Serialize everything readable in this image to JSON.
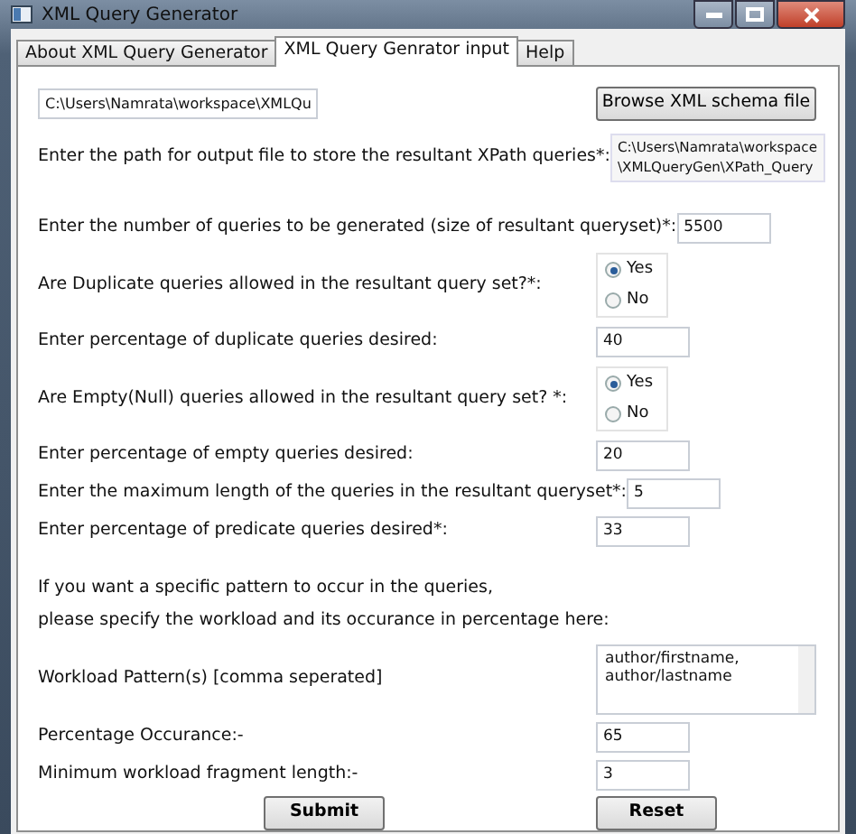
{
  "window": {
    "title": "XML Query Generator"
  },
  "tabs": [
    {
      "label": "About XML Query Generator",
      "selected": false
    },
    {
      "label": "XML Query Genrator input",
      "selected": true
    },
    {
      "label": "Help",
      "selected": false
    }
  ],
  "schema": {
    "value": "C:\\Users\\Namrata\\workspace\\XMLQu",
    "button": "Browse XML schema file"
  },
  "rows": [
    {
      "kind": "path",
      "label": "Enter the path for output file to store the resultant XPath queries*:",
      "lines": [
        "C:\\Users\\Namrata\\workspace",
        "\\XMLQueryGen\\XPath_Query"
      ]
    },
    {
      "kind": "input",
      "label": "Enter the number of queries to be generated (size of resultant queryset)*:",
      "value": "5500"
    },
    {
      "kind": "radio",
      "label": "Are Duplicate queries allowed in the resultant query set?*:",
      "options": [
        {
          "label": "Yes",
          "selected": true
        },
        {
          "label": "No",
          "selected": false
        }
      ]
    },
    {
      "kind": "input",
      "label": "Enter percentage of duplicate queries desired:",
      "value": "40"
    },
    {
      "kind": "radio",
      "label": "Are Empty(Null) queries allowed in the resultant query set? *:",
      "options": [
        {
          "label": "Yes",
          "selected": true
        },
        {
          "label": "No",
          "selected": false
        }
      ]
    },
    {
      "kind": "input",
      "label": "Enter percentage of empty queries desired:",
      "value": "20"
    },
    {
      "kind": "input",
      "label": "Enter the maximum length of the queries in the resultant queryset*:",
      "value": "5"
    },
    {
      "kind": "input",
      "label": "Enter percentage of predicate queries desired*:",
      "value": "33"
    },
    {
      "kind": "note",
      "lines": [
        "If you want a specific pattern to occur in the queries,",
        "please specify the workload and its occurance in percentage here:"
      ]
    },
    {
      "kind": "textarea",
      "label": "Workload Pattern(s) [comma seperated]",
      "value": "author/firstname,\nauthor/lastname"
    },
    {
      "kind": "input",
      "label": "Percentage Occurance:-",
      "value": "65"
    },
    {
      "kind": "input",
      "label": "Minimum workload fragment length:-",
      "value": "3"
    }
  ],
  "buttons": [
    "Submit",
    "Reset"
  ]
}
